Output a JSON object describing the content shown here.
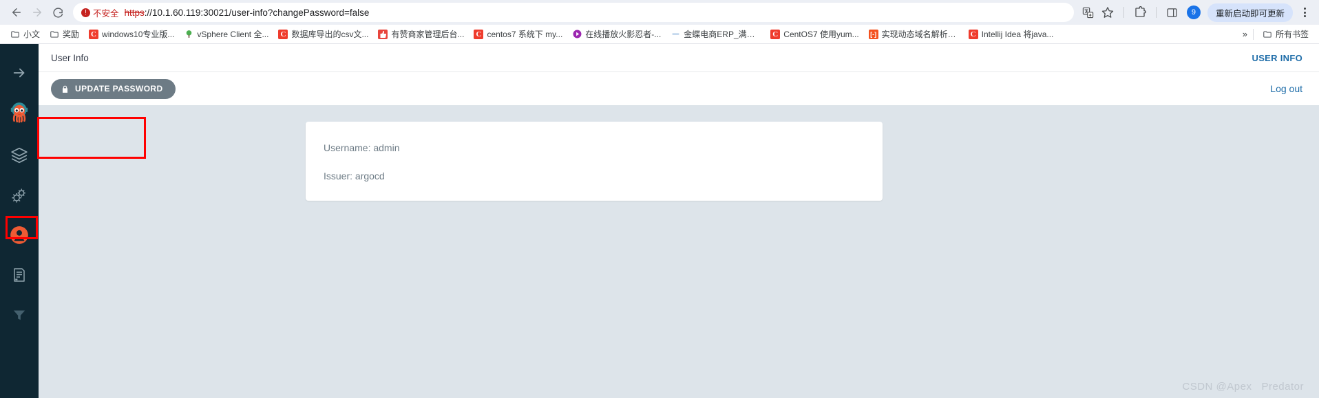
{
  "browser": {
    "back_label": "Back",
    "forward_label": "Forward",
    "reload_label": "Reload",
    "security_chip": "不安全",
    "url_scheme": "https",
    "url_rest": "://10.1.60.119:30021/user-info?changePassword=false",
    "translate_label": "translate-icon",
    "bookmark_star_label": "Bookmark this tab",
    "extensions_label": "Extensions",
    "side_panel_label": "Side panel",
    "profile_initial": "9",
    "update_pill": "重新启动即可更新",
    "menu_label": "Customize and control"
  },
  "bookmarks": {
    "items": [
      {
        "label": "小文",
        "icon": "folder-icon",
        "icon_type": "folder"
      },
      {
        "label": "奖励",
        "icon": "folder-icon",
        "icon_type": "folder"
      },
      {
        "label": "windows10专业版...",
        "icon": "csdn-icon",
        "icon_type": "c",
        "icon_text": "C"
      },
      {
        "label": "vSphere Client 全...",
        "icon": "tree-icon",
        "icon_type": "tree",
        "icon_text": "🌳"
      },
      {
        "label": "数据库导出的csv文...",
        "icon": "csdn-icon",
        "icon_type": "c",
        "icon_text": "C"
      },
      {
        "label": "有赞商家管理后台...",
        "icon": "thumb-up-icon",
        "icon_type": "thumb",
        "icon_text": "👍"
      },
      {
        "label": "centos7 系统下 my...",
        "icon": "csdn-icon",
        "icon_type": "c",
        "icon_text": "C"
      },
      {
        "label": "在线播放火影忍者-...",
        "icon": "play-icon",
        "icon_type": "play",
        "icon_text": "▶"
      },
      {
        "label": "金蝶电商ERP_满足...",
        "icon": "dash-icon",
        "icon_type": "dash",
        "icon_text": "—"
      },
      {
        "label": "CentOS7 使用yum...",
        "icon": "csdn-icon",
        "icon_type": "c",
        "icon_text": "C"
      },
      {
        "label": "实现动态域名解析D...",
        "icon": "bracket-icon",
        "icon_type": "bracket",
        "icon_text": "[-]"
      },
      {
        "label": "Intellij Idea 将java...",
        "icon": "csdn-icon",
        "icon_type": "c",
        "icon_text": "C"
      }
    ],
    "overflow_label": "»",
    "all_bookmarks_label": "所有书签"
  },
  "sidebar": {
    "items": [
      {
        "name": "collapse-arrow",
        "label": "Collapse"
      },
      {
        "name": "argocd-logo",
        "label": "Argo CD"
      },
      {
        "name": "applications",
        "label": "Applications"
      },
      {
        "name": "settings",
        "label": "Settings"
      },
      {
        "name": "user-info",
        "label": "User Info",
        "active": true
      },
      {
        "name": "documentation",
        "label": "Documentation"
      },
      {
        "name": "filter",
        "label": "Filter"
      }
    ]
  },
  "page": {
    "title": "User Info",
    "tab_label": "USER INFO",
    "update_password_button": "UPDATE PASSWORD",
    "lock_icon": "lock-icon",
    "logout_label": "Log out"
  },
  "user_info": {
    "username_row": "Username: admin",
    "issuer_row": "Issuer: argocd"
  },
  "watermark": "CSDN @Apex   Predator",
  "colors": {
    "sidebar_bg": "#0f2733",
    "content_bg": "#dde4ea",
    "accent_link": "#1d6ca8",
    "button_gray": "#6d7b85",
    "annotation_red": "#ff0000",
    "argo_orange": "#ef5b34"
  }
}
